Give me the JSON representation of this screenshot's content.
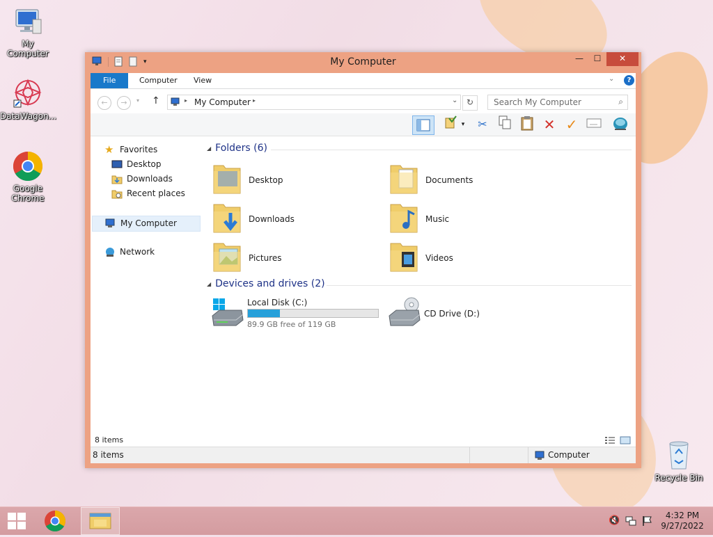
{
  "desktop": {
    "icons": [
      {
        "label": "My Computer"
      },
      {
        "label": "DataWagon..."
      },
      {
        "label": "Google Chrome"
      },
      {
        "label": "Recycle Bin"
      }
    ]
  },
  "window": {
    "title": "My Computer",
    "controls": {
      "minimize": "—",
      "maximize": "☐",
      "close": "✕"
    },
    "ribbon_tabs": [
      "File",
      "Computer",
      "View"
    ],
    "address": {
      "location": "My Computer"
    },
    "search": {
      "placeholder": "Search My Computer"
    },
    "nav": {
      "favorites": "Favorites",
      "desktop": "Desktop",
      "downloads": "Downloads",
      "recent": "Recent places",
      "computer": "My Computer",
      "network": "Network"
    },
    "folders": {
      "header": "Folders (6)",
      "items": [
        "Desktop",
        "Documents",
        "Downloads",
        "Music",
        "Pictures",
        "Videos"
      ]
    },
    "drives": {
      "header": "Devices and drives (2)",
      "local": {
        "name": "Local Disk (C:)",
        "free_text": "89.9 GB free of 119 GB",
        "used_fraction": 0.245
      },
      "cd": {
        "name": "CD Drive (D:)"
      }
    },
    "status_inner": "8 items",
    "statusbar": {
      "left": "8 items",
      "right": "Computer"
    }
  },
  "taskbar": {
    "time": "4:32 PM",
    "date": "9/27/2022"
  },
  "colors": {
    "accent": "#1979ca",
    "window_frame": "#eda283",
    "taskbar": "#d8a2a6",
    "folder": "#f0cd6a"
  }
}
